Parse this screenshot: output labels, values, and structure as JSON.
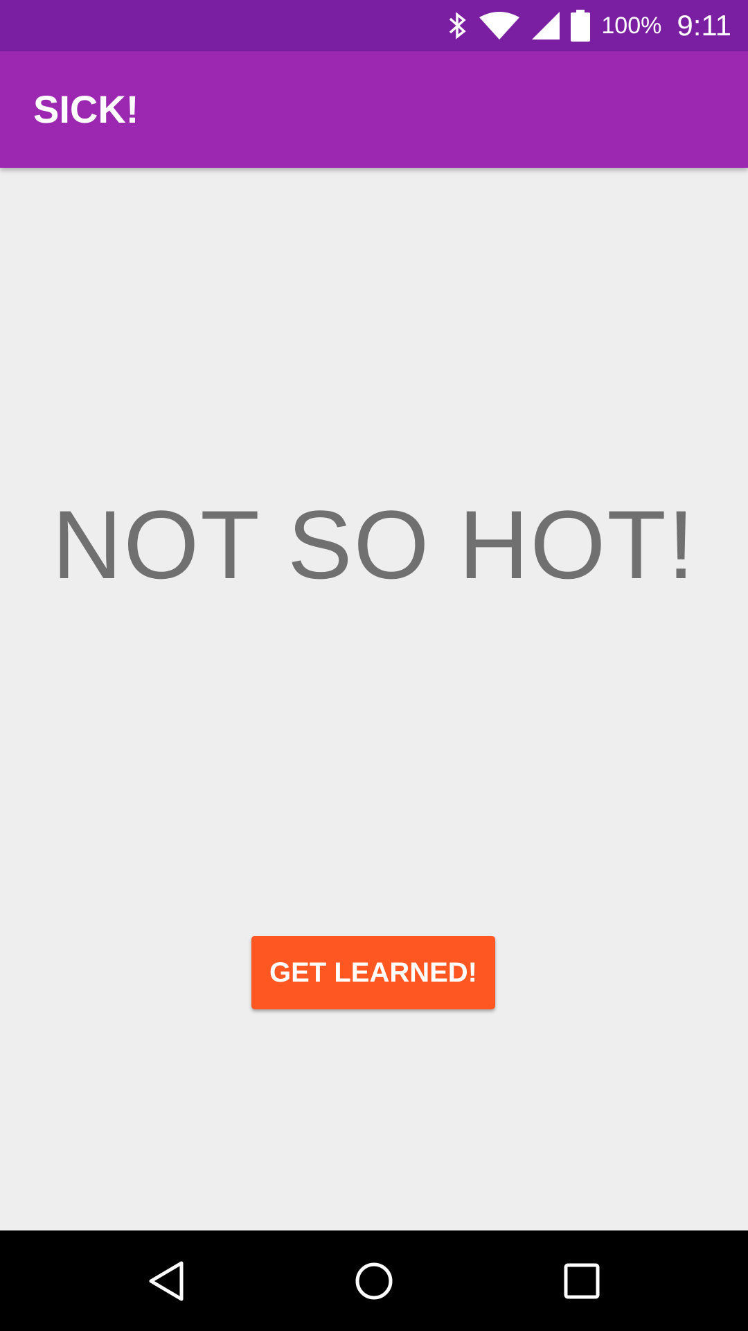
{
  "status_bar": {
    "battery_percent": "100%",
    "time": "9:11",
    "icons": [
      "bluetooth-icon",
      "wifi-icon",
      "cell-signal-icon",
      "battery-icon"
    ]
  },
  "app_bar": {
    "title": "SICK!"
  },
  "main": {
    "headline": "NOT SO HOT!",
    "button_label": "GET LEARNED!"
  },
  "nav_bar": {
    "icons": [
      "back-icon",
      "home-icon",
      "recents-icon"
    ]
  },
  "colors": {
    "status_bar": "#7b1fa2",
    "app_bar": "#9c27b0",
    "background": "#eeeeee",
    "headline": "#707070",
    "button": "#ff5722",
    "nav_bar": "#000000"
  }
}
